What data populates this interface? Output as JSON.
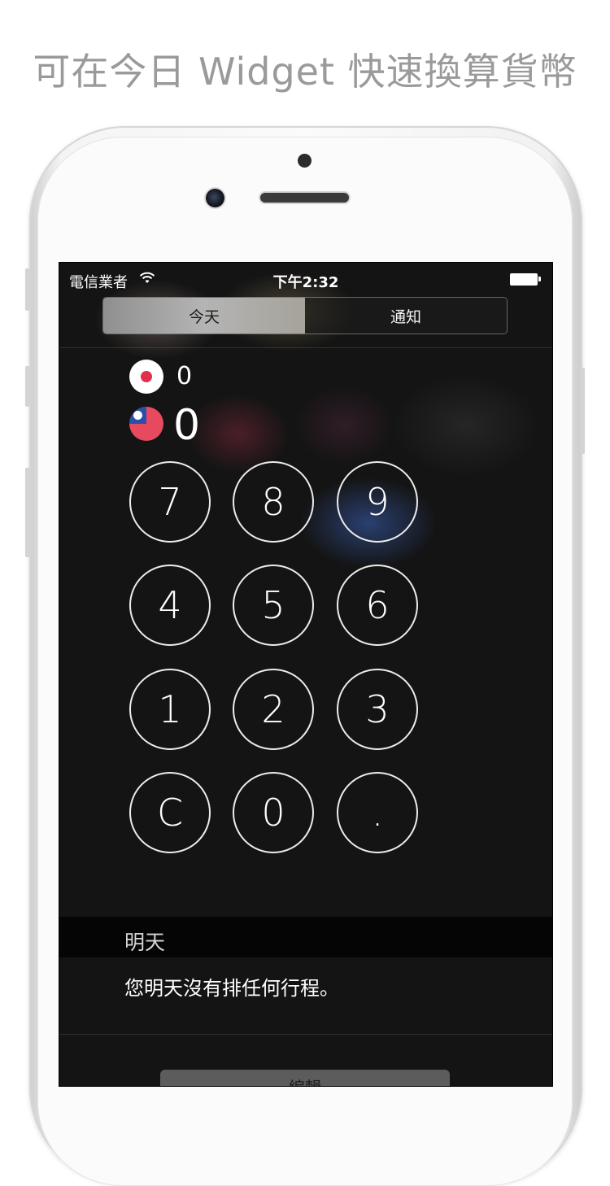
{
  "headline": "可在今日 Widget 快速換算貨幣",
  "status_bar": {
    "carrier": "電信業者",
    "time": "下午2:32"
  },
  "segmented_control": {
    "today": "今天",
    "notifications": "通知"
  },
  "converter": {
    "source_currency_flag": "japan-flag",
    "source_value": "0",
    "target_currency_flag": "taiwan-flag",
    "target_value": "0"
  },
  "keypad": {
    "k7": "7",
    "k8": "8",
    "k9": "9",
    "k4": "4",
    "k5": "5",
    "k6": "6",
    "k1": "1",
    "k2": "2",
    "k3": "3",
    "clear": "C",
    "k0": "0",
    "dot": "."
  },
  "tomorrow": {
    "title": "明天",
    "message": "您明天沒有排任何行程。"
  },
  "edit_button": "編輯"
}
